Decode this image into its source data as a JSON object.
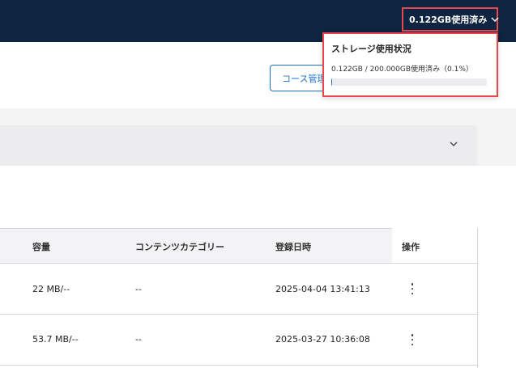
{
  "header": {
    "storage_button_label": "0.122GB使用済み"
  },
  "toolbar": {
    "course_button_label": "コース管理"
  },
  "storage_popover": {
    "title": "ストレージ使用状況",
    "usage_text": "0.122GB / 200.000GB使用済み（0.1%）",
    "used_gb": 0.122,
    "total_gb": 200.0,
    "used_fraction": 0.001,
    "bar_color": "#1f6fd1"
  },
  "table": {
    "columns": [
      "容量",
      "コンテンツカテゴリー",
      "登録日時",
      "操作"
    ],
    "rows": [
      {
        "size": "22 MB/--",
        "category": "--",
        "registered": "2025-04-04 13:41:13"
      },
      {
        "size": "53.7 MB/--",
        "category": "--",
        "registered": "2025-03-27 10:36:08"
      }
    ]
  },
  "colors": {
    "header_bg": "#0f2441",
    "accent": "#1f6fd1",
    "highlight": "#e5484d"
  }
}
